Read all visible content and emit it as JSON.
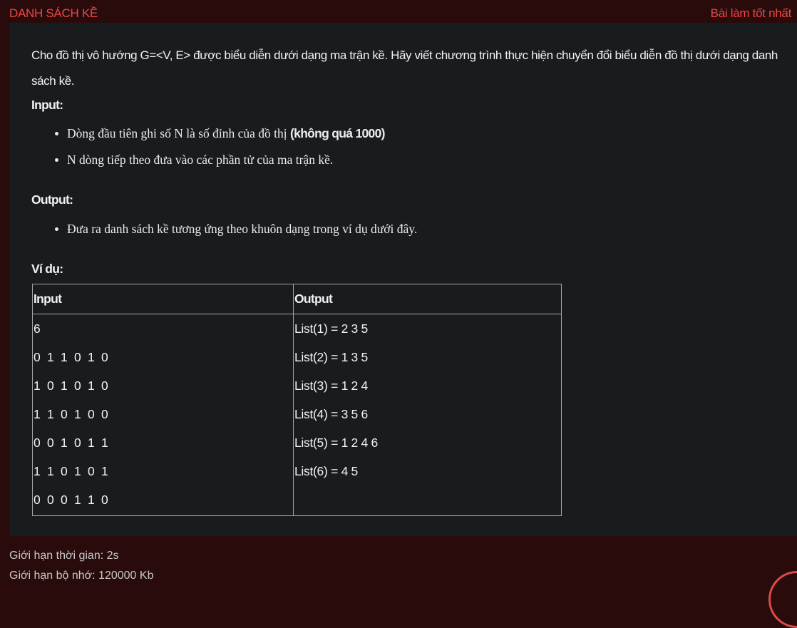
{
  "header": {
    "title": "DANH SÁCH KỀ",
    "best_solution_link": "Bài làm tốt nhất"
  },
  "problem": {
    "description": "Cho đồ thị vô hướng G=<V, E> được biểu diễn dưới dạng ma trận kề. Hãy viết chương trình thực hiện chuyển đổi biểu diễn đồ thị dưới dạng danh sách kề.",
    "input_heading": "Input:",
    "input_item1_text": "Dòng đầu tiên ghi số N là số đỉnh của đồ thị ",
    "input_item1_bold": "(không quá 1000)",
    "input_item2": "N dòng tiếp theo đưa vào các phần tử của ma trận kề.",
    "output_heading": "Output:",
    "output_item1": "Đưa ra danh sách kề tương ứng theo khuôn dạng trong ví dụ dưới đây.",
    "example_heading": "Ví dụ:"
  },
  "example_table": {
    "headers": [
      "Input",
      "Output"
    ],
    "input_lines": [
      "6",
      "0 1 1 0 1 0",
      "1 0 1 0 1 0",
      "1 1 0 1 0 0",
      "0 0 1 0 1 1",
      "1 1 0 1 0 1",
      "0 0 0 1 1 0"
    ],
    "output_lines": [
      "List(1) = 2 3 5",
      "List(2) = 1 3 5",
      "List(3) = 1 2 4",
      "List(4) = 3 5 6",
      "List(5) = 1 2 4 6",
      "List(6) = 4 5"
    ]
  },
  "limits": {
    "time": "Giới hạn thời gian: 2s",
    "memory": "Giới hạn bộ nhớ: 120000 Kb"
  },
  "colors": {
    "background": "#2a0b0b",
    "panel": "#191c1e",
    "accent": "#f04646"
  }
}
